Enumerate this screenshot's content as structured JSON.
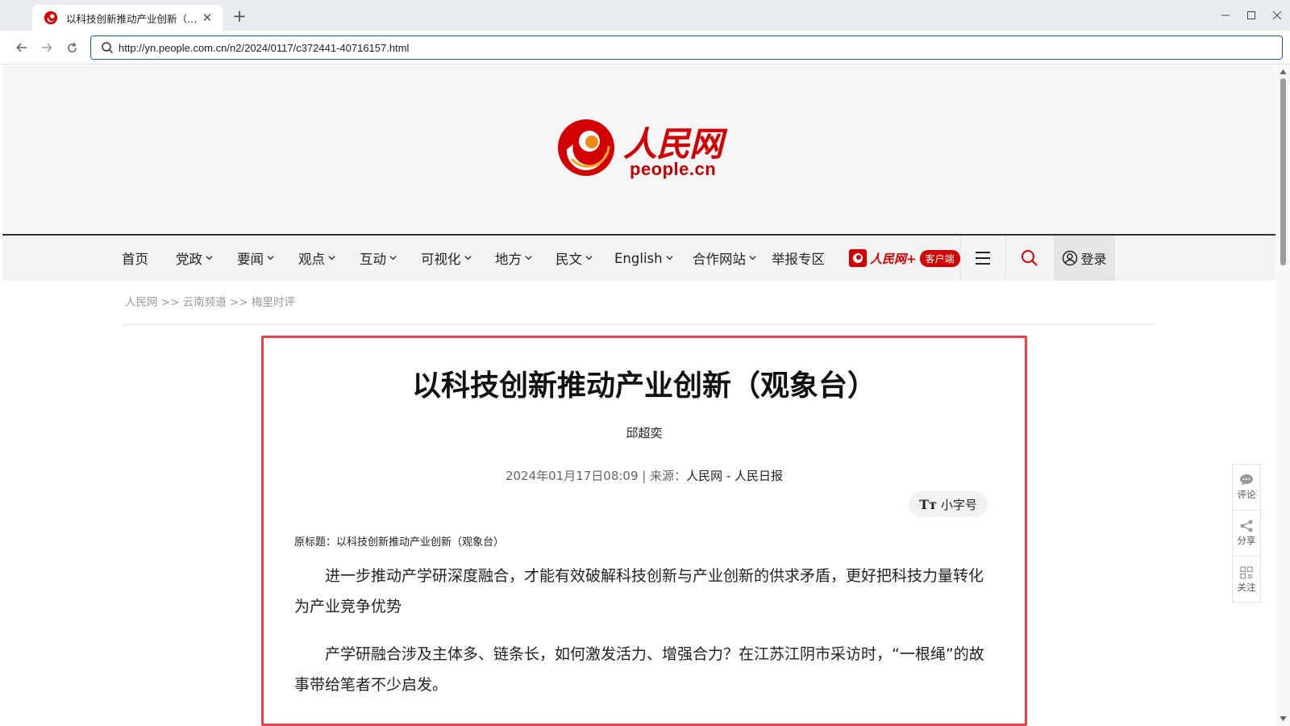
{
  "browser": {
    "tab_title": "以科技创新推动产业创新（观...",
    "url": "http://yn.people.com.cn/n2/2024/0117/c372441-40716157.html"
  },
  "site": {
    "logo_cn": "人民网",
    "logo_en": "people.cn",
    "brand_color": "#d40000"
  },
  "nav": {
    "items": [
      {
        "label": "首页",
        "dropdown": false
      },
      {
        "label": "党政",
        "dropdown": true
      },
      {
        "label": "要闻",
        "dropdown": true
      },
      {
        "label": "观点",
        "dropdown": true
      },
      {
        "label": "互动",
        "dropdown": true
      },
      {
        "label": "可视化",
        "dropdown": true
      },
      {
        "label": "地方",
        "dropdown": true
      },
      {
        "label": "民文",
        "dropdown": true
      },
      {
        "label": "English",
        "dropdown": true
      },
      {
        "label": "合作网站",
        "dropdown": true
      },
      {
        "label": "举报专区",
        "dropdown": false
      }
    ],
    "app_name": "人民网+",
    "app_pill": "客户端",
    "login": "登录"
  },
  "breadcrumb": {
    "parts": [
      "人民网",
      ">>",
      "云南频道",
      ">>",
      "梅里时评"
    ]
  },
  "article": {
    "title": "以科技创新推动产业创新（观象台）",
    "author": "邱超奕",
    "date": "2024年01月17日08:09",
    "sep": " | 来源：",
    "source": "人民网 - 人民日报",
    "font_toggle": "小字号",
    "font_toggle_icon": "Tт",
    "original_title": "原标题：以科技创新推动产业创新（观象台）",
    "paragraphs": [
      "进一步推动产学研深度融合，才能有效破解科技创新与产业创新的供求矛盾，更好把科技力量转化为产业竞争优势",
      "产学研融合涉及主体多、链条长，如何激发活力、增强合力？在江苏江阴市采访时，“一根绳”的故事带给笔者不少启发。"
    ]
  },
  "side_tools": {
    "comment": "评论",
    "share": "分享",
    "follow": "关注"
  }
}
